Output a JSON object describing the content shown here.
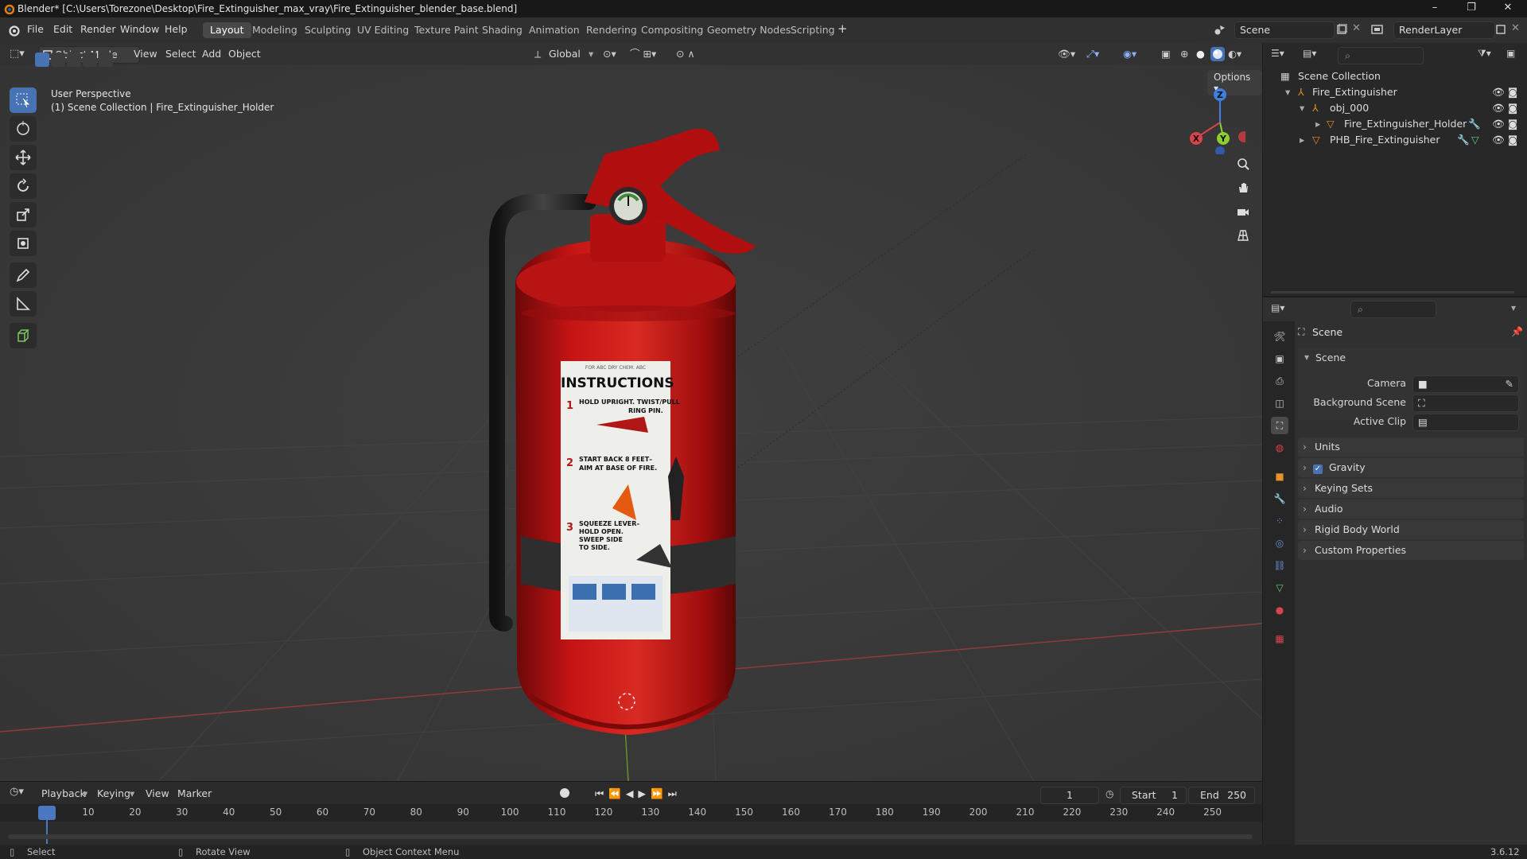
{
  "window": {
    "title": "Blender* [C:\\Users\\Torezone\\Desktop\\Fire_Extinguisher_max_vray\\Fire_Extinguisher_blender_base.blend]",
    "minimize": "–",
    "maximize": "❐",
    "close": "✕"
  },
  "menu": [
    "File",
    "Edit",
    "Render",
    "Window",
    "Help"
  ],
  "workspaces": [
    "Layout",
    "Modeling",
    "Sculpting",
    "UV Editing",
    "Texture Paint",
    "Shading",
    "Animation",
    "Rendering",
    "Compositing",
    "Geometry Nodes",
    "Scripting"
  ],
  "add_workspace": "+",
  "scene_field": "Scene",
  "render_layer_field": "RenderLayer",
  "viewport": {
    "mode": "Object Mode",
    "menus": [
      "View",
      "Select",
      "Add",
      "Object"
    ],
    "transform_orientation": "Global",
    "options_label": "Options",
    "overlay_line1": "User Perspective",
    "overlay_line2": "(1) Scene Collection | Fire_Extinguisher_Holder",
    "gizmo": {
      "x": "X",
      "y": "Y",
      "z": "Z"
    }
  },
  "label_sticker": {
    "header": "FOR ABC DRY CHEM. ABC",
    "title": "INSTRUCTIONS",
    "step1_num": "1",
    "step1_l1": "HOLD UPRIGHT. TWIST/PULL",
    "step1_l2": "RING PIN.",
    "step2_num": "2",
    "step2_l1": "START BACK 8 FEET–",
    "step2_l2": "AIM AT BASE OF FIRE.",
    "step3_num": "3",
    "step3_l1": "SQUEEZE LEVER–",
    "step3_l2": "HOLD OPEN.",
    "step3_l3": "SWEEP SIDE",
    "step3_l4": "TO SIDE."
  },
  "outliner": {
    "root": "Scene Collection",
    "items": [
      {
        "label": "Fire_Extinguisher"
      },
      {
        "label": "obj_000"
      },
      {
        "label": "Fire_Extinguisher_Holder"
      },
      {
        "label": "PHB_Fire_Extinguisher"
      }
    ]
  },
  "properties": {
    "context": "Scene",
    "panel_title": "Scene",
    "fields": [
      {
        "label": "Camera"
      },
      {
        "label": "Background Scene"
      },
      {
        "label": "Active Clip"
      }
    ],
    "sections": [
      "Units",
      "Gravity",
      "Keying Sets",
      "Audio",
      "Rigid Body World",
      "Custom Properties"
    ]
  },
  "timeline": {
    "menus": [
      "Playback",
      "Keying",
      "View",
      "Marker"
    ],
    "current_frame": "1",
    "start_label": "Start",
    "start": "1",
    "end_label": "End",
    "end": "250",
    "ticks": [
      "1",
      "10",
      "20",
      "30",
      "40",
      "50",
      "60",
      "70",
      "80",
      "90",
      "100",
      "110",
      "120",
      "130",
      "140",
      "150",
      "160",
      "170",
      "180",
      "190",
      "200",
      "210",
      "220",
      "230",
      "240",
      "250"
    ]
  },
  "status": {
    "select": "Select",
    "rotate": "Rotate View",
    "context_menu": "Object Context Menu",
    "version": "3.6.12"
  },
  "colors": {
    "accent": "#4772b3",
    "axis_x": "#d9434b",
    "axis_y": "#8ccf2f",
    "axis_z": "#3f7fe0",
    "extinguisher_red": "#c41414",
    "playhead": "#4a78c0"
  }
}
